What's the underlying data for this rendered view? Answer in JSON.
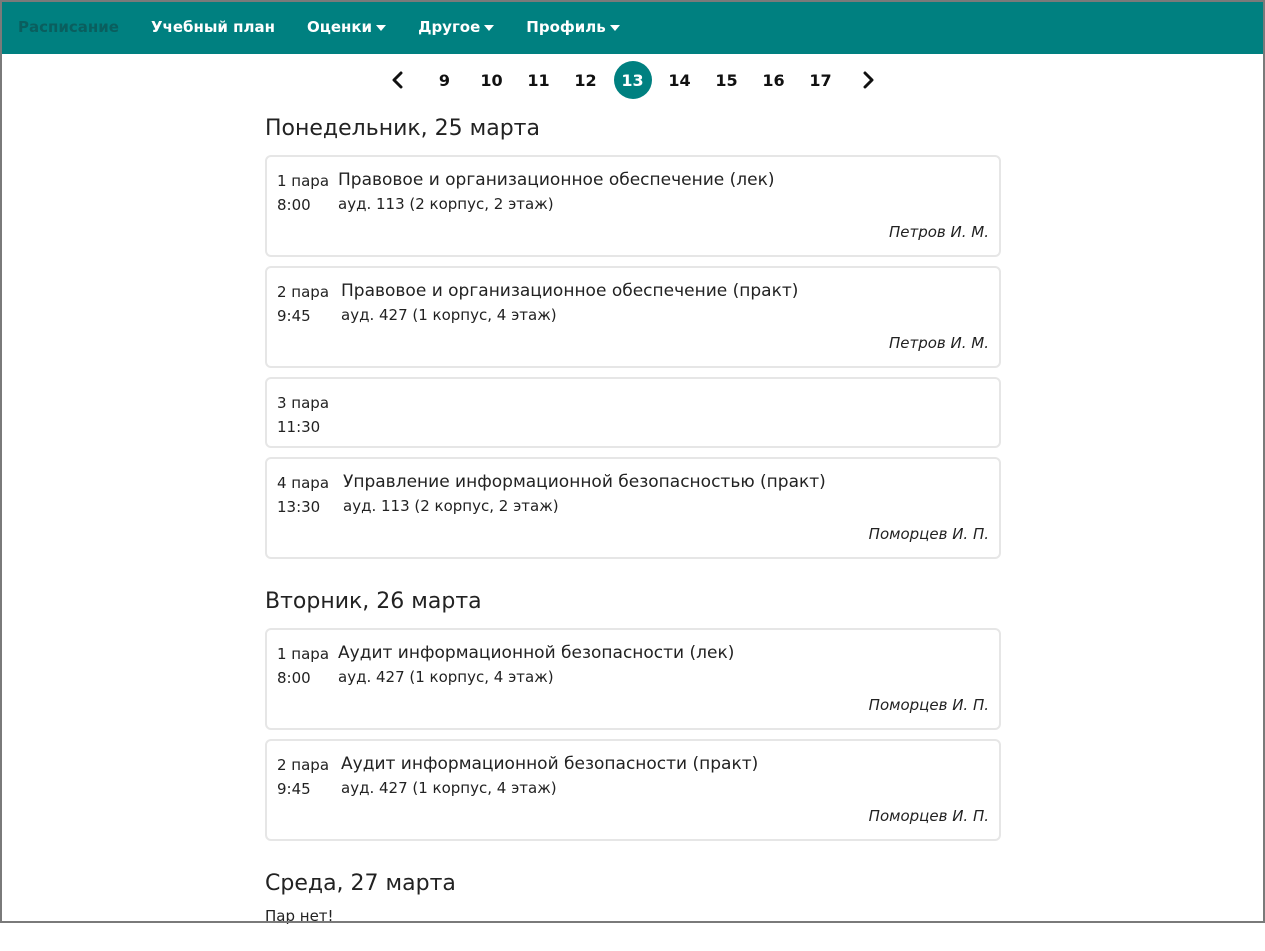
{
  "navbar": {
    "items": [
      {
        "label": "Расписание",
        "active": true,
        "dropdown": false
      },
      {
        "label": "Учебный план",
        "active": false,
        "dropdown": false
      },
      {
        "label": "Оценки",
        "active": false,
        "dropdown": true
      },
      {
        "label": "Другое",
        "active": false,
        "dropdown": true
      },
      {
        "label": "Профиль",
        "active": false,
        "dropdown": true
      }
    ]
  },
  "pager": {
    "prev_icon": "chevron-left-icon",
    "next_icon": "chevron-right-icon",
    "weeks": [
      "9",
      "10",
      "11",
      "12",
      "13",
      "14",
      "15",
      "16",
      "17"
    ],
    "active_week": "13"
  },
  "days": [
    {
      "title": "Понедельник, 25 марта",
      "lessons": [
        {
          "number": "1 пара",
          "time": "8:00",
          "subject": "Правовое и организационное обеспечение (лек)",
          "room": "ауд. 113 (2 корпус, 2 этаж)",
          "teacher": "Петров И. М."
        },
        {
          "number": "2 пара",
          "time": "9:45",
          "subject": "Правовое и организационное обеспечение (практ)",
          "room": "ауд. 427 (1 корпус, 4 этаж)",
          "teacher": "Петров И. М."
        },
        {
          "number": "3 пара",
          "time": "11:30",
          "subject": "",
          "room": "",
          "teacher": ""
        },
        {
          "number": "4 пара",
          "time": "13:30",
          "subject": "Управление информационной безопасностью (практ)",
          "room": "ауд. 113 (2 корпус, 2 этаж)",
          "teacher": "Поморцев И. П."
        }
      ]
    },
    {
      "title": "Вторник, 26 марта",
      "lessons": [
        {
          "number": "1 пара",
          "time": "8:00",
          "subject": "Аудит информационной безопасности (лек)",
          "room": "ауд. 427 (1 корпус, 4 этаж)",
          "teacher": "Поморцев И. П."
        },
        {
          "number": "2 пара",
          "time": "9:45",
          "subject": "Аудит информационной безопасности (практ)",
          "room": "ауд. 427 (1 корпус, 4 этаж)",
          "teacher": "Поморцев И. П."
        }
      ]
    },
    {
      "title": "Среда, 27 марта",
      "no_lessons_text": "Пар нет!",
      "lessons": []
    }
  ],
  "colors": {
    "accent": "#008080",
    "active_nav_text": "#0a5e5e",
    "card_border": "#e6e6e6"
  }
}
